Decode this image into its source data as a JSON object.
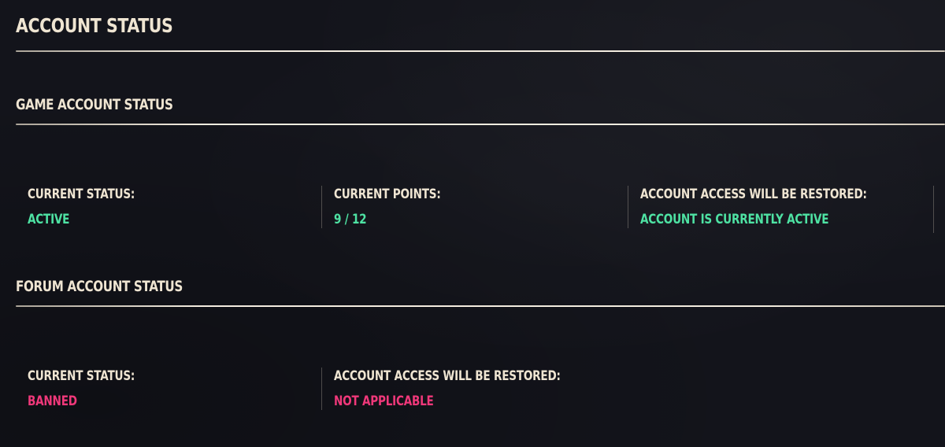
{
  "page": {
    "title": "Account Status"
  },
  "game": {
    "heading": "Game Account Status",
    "stats": [
      {
        "label": "Current Status:",
        "value": "Active"
      },
      {
        "label": "Current Points:",
        "value": "9 / 12"
      },
      {
        "label": "Account Access Will Be Restored:",
        "value": "Account is currently active"
      }
    ]
  },
  "forum": {
    "heading": "Forum Account Status",
    "stats": [
      {
        "label": "Current Status:",
        "value": "Banned"
      },
      {
        "label": "Account Access Will Be Restored:",
        "value": "Not Applicable"
      }
    ]
  },
  "colors": {
    "background": "#13141b",
    "text": "#efe5d2",
    "status_active": "#4ee2a3",
    "status_banned": "#f0387a"
  }
}
